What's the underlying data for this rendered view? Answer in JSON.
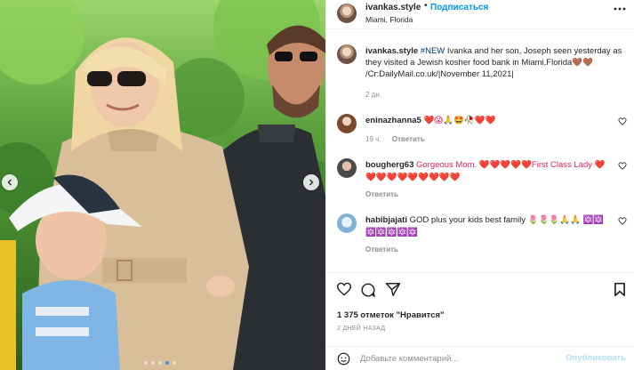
{
  "post": {
    "username": "ivankas.style",
    "separator": "•",
    "follow_label": "Подписаться",
    "location": "Miami, Florida",
    "more_icon": "more-horizontal-icon"
  },
  "caption": {
    "username": "ivankas.style",
    "hashtag": "#NEW",
    "text": " Ivanka and her son, Joseph seen yesterday as they visited a Jewish kosher food bank in Miami,Florida🤎🤎 /Cr:DailyMail.co.uk/|November 11,2021|",
    "time": "2 дн."
  },
  "comments": [
    {
      "username": "eninazhanna5",
      "text": " ❤️😱🙏🤩🥀❤️❤️",
      "time": "19 ч.",
      "reply_label": "Ответить"
    },
    {
      "username": "bougherg63",
      "text": " Gorgeous Mom. ❤️❤️❤️❤️❤️First Class Lady ❤️❤️❤️❤️❤️❤️❤️❤️❤️❤️",
      "time": "",
      "reply_label": "Ответить"
    },
    {
      "username": "habibjajati",
      "text": " GOD plus your kids best family 🌷🌷🌷🙏🙏 🔯🔯🔯🔯🔯🔯🔯",
      "time": "",
      "reply_label": "Ответить"
    }
  ],
  "actions": {
    "likes": "1 375 отметок \"Нравится\"",
    "age": "2 ДНЕЙ НАЗАД"
  },
  "add_comment": {
    "placeholder": "Добавьте комментарий...",
    "post_label": "Опубликовать"
  },
  "colors": {
    "link_blue": "#0095f6",
    "hashtag": "#00376b",
    "muted": "#8e8e8e",
    "border": "#efefef",
    "post_disabled": "#b2dffc"
  },
  "carousel": {
    "slides": 5,
    "active": 4
  }
}
